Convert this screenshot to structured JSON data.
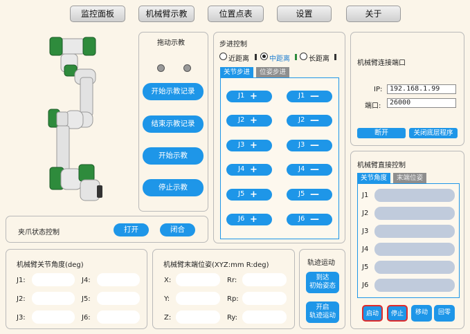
{
  "nav": {
    "tabs": [
      "监控面板",
      "机械臂示教",
      "位置点表",
      "设置",
      "关于"
    ]
  },
  "drag_teach": {
    "title": "拖动示教",
    "buttons": [
      "开始示教记录",
      "结束示教记录",
      "开始示教",
      "停止示教"
    ]
  },
  "step_control": {
    "title": "步进控制",
    "distances": [
      "近距离",
      "中距离",
      "长距离"
    ],
    "selected_distance": "中距离",
    "tabs": [
      "关节步进",
      "位姿步进"
    ],
    "active_tab": "关节步进",
    "joints": [
      {
        "plus": "J1",
        "minus": "J1"
      },
      {
        "plus": "J2",
        "minus": "J2"
      },
      {
        "plus": "J3",
        "minus": "J3"
      },
      {
        "plus": "J4",
        "minus": "J4"
      },
      {
        "plus": "J5",
        "minus": "J5"
      },
      {
        "plus": "J6",
        "minus": "J6"
      }
    ],
    "plus_symbol": "+",
    "minus_symbol": "—"
  },
  "connection": {
    "title": "机械臂连接端口",
    "ip_label": "IP:",
    "ip_value": "192.168.1.99",
    "port_label": "端口:",
    "port_value": "26000",
    "disconnect": "断开",
    "close_program": "关闭底层程序"
  },
  "direct_control": {
    "title": "机械臂直接控制",
    "tabs": [
      "关节角度",
      "末端位姿"
    ],
    "active_tab": "关节角度",
    "joints": [
      "J1",
      "J2",
      "J3",
      "J4",
      "J5",
      "J6"
    ],
    "buttons": [
      "启动",
      "停止",
      "移动",
      "回零"
    ]
  },
  "gripper": {
    "title": "夹爪状态控制",
    "open": "打开",
    "close": "闭合"
  },
  "joint_angles": {
    "title": "机械臂关节角度(deg)",
    "labels": [
      "J1:",
      "J4:",
      "J2:",
      "J5:",
      "J3:",
      "J6:"
    ]
  },
  "end_pose": {
    "title": "机械臂末端位姿(XYZ:mm R:deg)",
    "labels": [
      "X:",
      "Rr:",
      "Y:",
      "Rp:",
      "Z:",
      "Ry:"
    ]
  },
  "trajectory": {
    "title": "轨迹运动",
    "btn1_line1": "到达",
    "btn1_line2": "初始姿态",
    "btn2_line1": "开启",
    "btn2_line2": "轨迹运动"
  },
  "colors": {
    "accent": "#1e96e8",
    "background": "#fbf5e9",
    "robot_green": "#2e8b3c",
    "stop_border": "#e02b2b"
  }
}
